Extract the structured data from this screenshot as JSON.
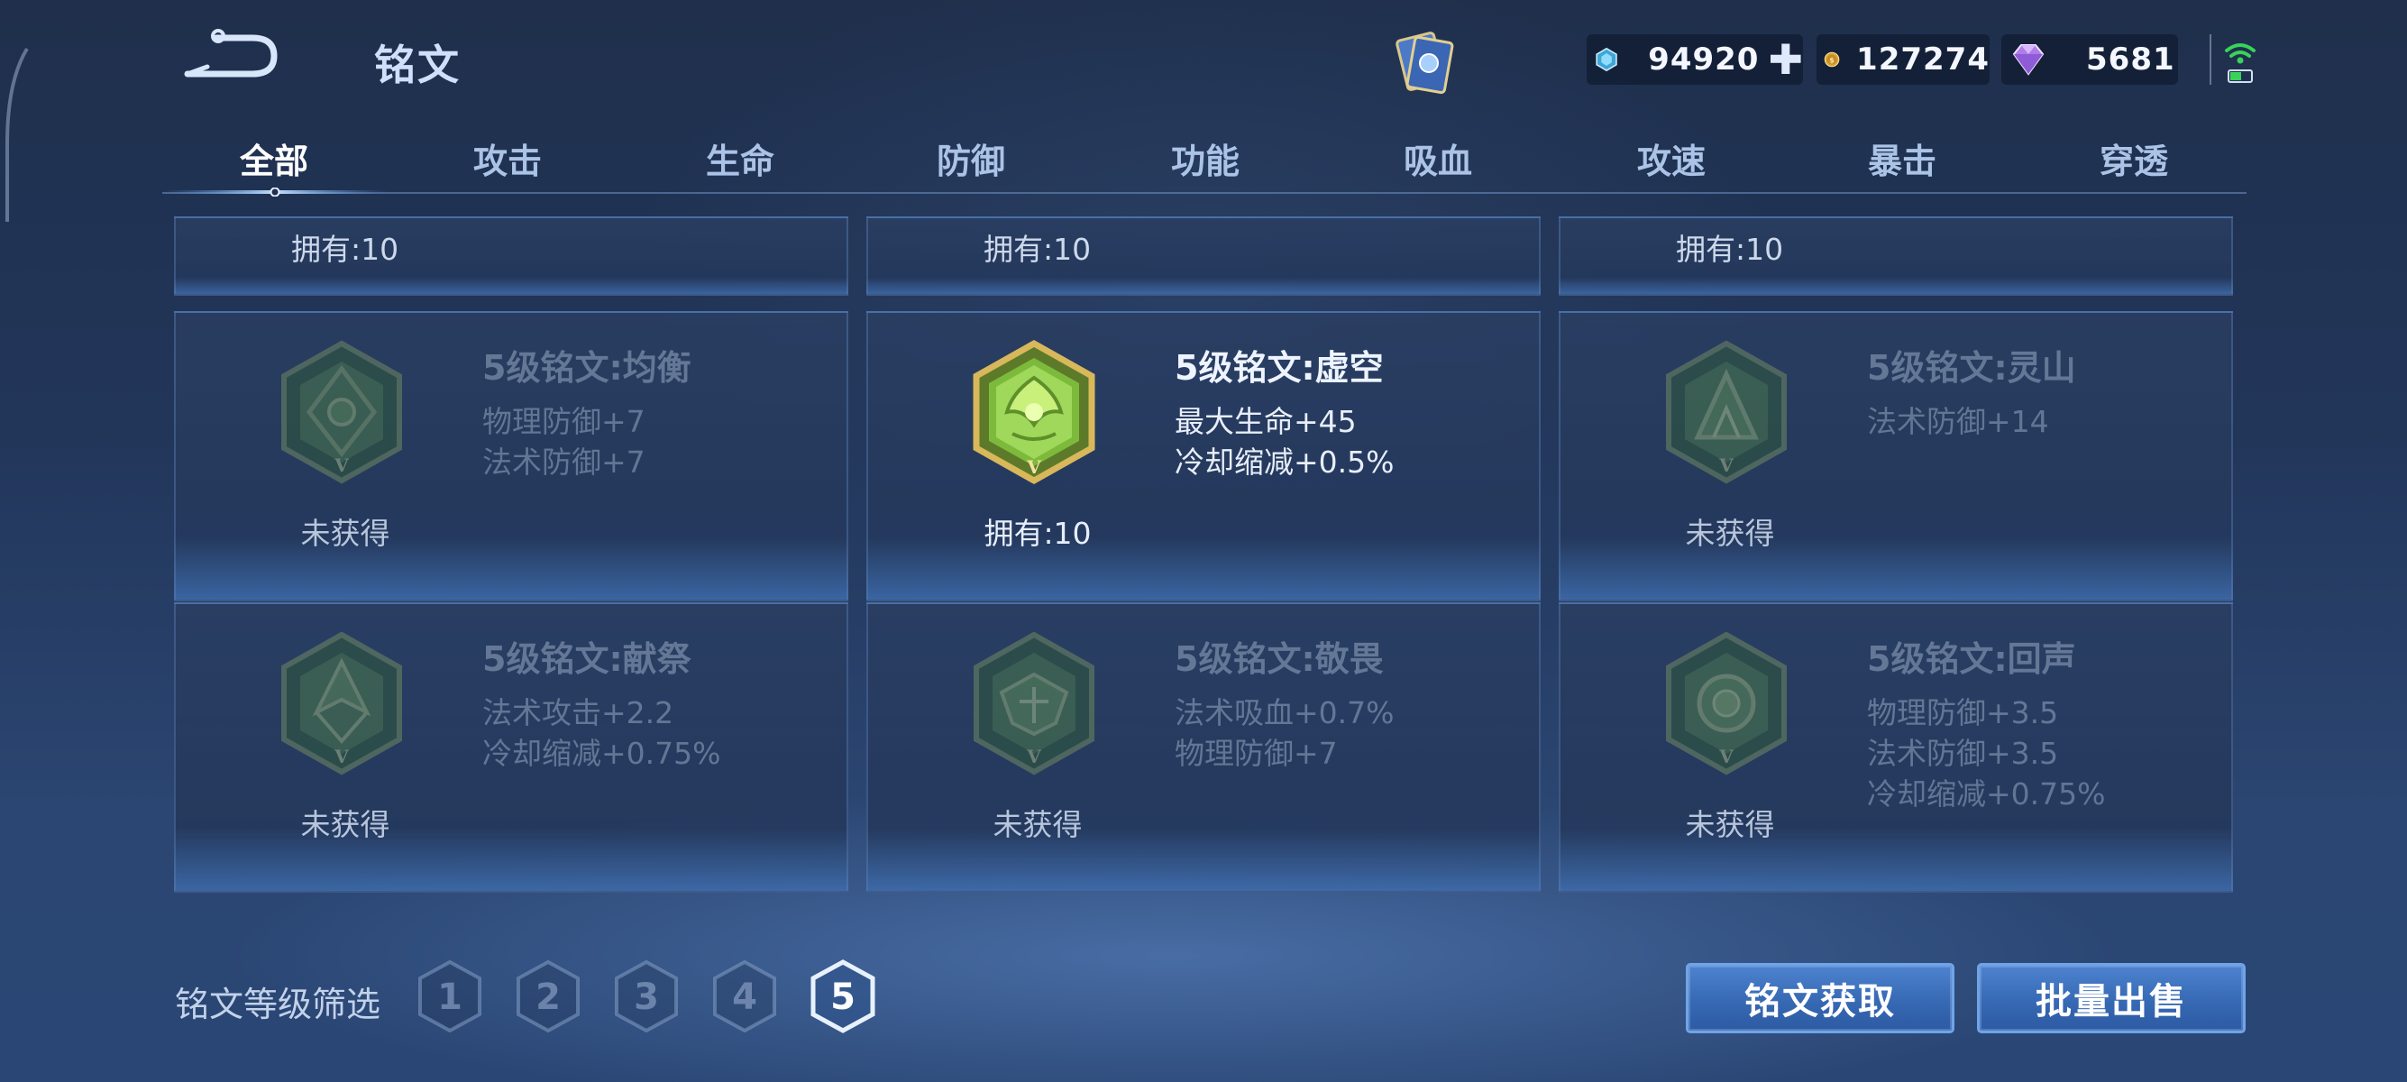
{
  "header": {
    "title": "铭文",
    "currencies": [
      {
        "name": "diamond",
        "value": "94920",
        "icon": "blue-diamond-icon"
      },
      {
        "name": "gold",
        "value": "127274",
        "icon": "gold-coin-icon"
      },
      {
        "name": "gem",
        "value": "5681",
        "icon": "purple-gem-icon"
      }
    ],
    "plus_symbol": "✚"
  },
  "tabs": [
    {
      "label": "全部",
      "active": true
    },
    {
      "label": "攻击"
    },
    {
      "label": "生命"
    },
    {
      "label": "防御"
    },
    {
      "label": "功能"
    },
    {
      "label": "吸血"
    },
    {
      "label": "攻速"
    },
    {
      "label": "暴击"
    },
    {
      "label": "穿透"
    }
  ],
  "partial_row": [
    {
      "owned": "拥有:10"
    },
    {
      "owned": "拥有:10"
    },
    {
      "owned": "拥有:10"
    }
  ],
  "inscriptions": [
    {
      "name": "5级铭文:均衡",
      "attrs": [
        "物理防御+7",
        "法术防御+7"
      ],
      "status": "未获得",
      "owned": false,
      "icon": "rune-balance-icon"
    },
    {
      "name": "5级铭文:虚空",
      "attrs": [
        "最大生命+45",
        "冷却缩减+0.5%"
      ],
      "status": "拥有:10",
      "owned": true,
      "icon": "rune-void-icon"
    },
    {
      "name": "5级铭文:灵山",
      "attrs": [
        "法术防御+14"
      ],
      "status": "未获得",
      "owned": false,
      "icon": "rune-spirit-mountain-icon"
    },
    {
      "name": "5级铭文:献祭",
      "attrs": [
        "法术攻击+2.2",
        "冷却缩减+0.75%"
      ],
      "status": "未获得",
      "owned": false,
      "icon": "rune-sacrifice-icon"
    },
    {
      "name": "5级铭文:敬畏",
      "attrs": [
        "法术吸血+0.7%",
        "物理防御+7"
      ],
      "status": "未获得",
      "owned": false,
      "icon": "rune-awe-icon"
    },
    {
      "name": "5级铭文:回声",
      "attrs": [
        "物理防御+3.5",
        "法术防御+3.5",
        "冷却缩减+0.75%"
      ],
      "status": "未获得",
      "owned": false,
      "icon": "rune-echo-icon"
    }
  ],
  "footer": {
    "filter_label": "铭文等级筛选",
    "levels": [
      "1",
      "2",
      "3",
      "4",
      "5"
    ],
    "selected_level": "5",
    "obtain_label": "铭文获取",
    "bulk_sell_label": "批量出售"
  },
  "colors": {
    "accent_blue": "#3f75c4",
    "owned_rune_green": "#7cc24a",
    "rune_gold_border": "#c9a64a"
  }
}
